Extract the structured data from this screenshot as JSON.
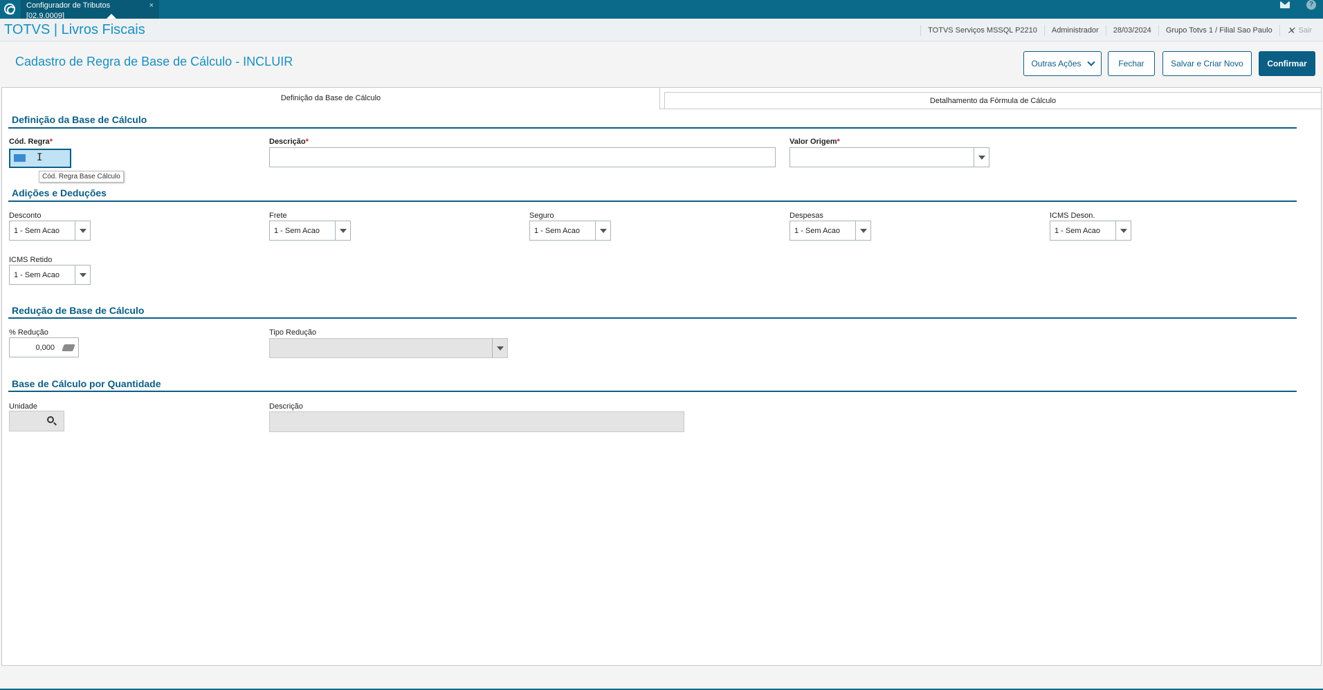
{
  "window": {
    "tab_title": "Configurador de Tributos [02.9.0009]",
    "tab_close": "×"
  },
  "header": {
    "brand": "TOTVS | Livros Fiscais",
    "environment": "TOTVS Serviços MSSQL P2210",
    "user": "Administrador",
    "date": "28/03/2024",
    "company": "Grupo Totvs 1 / Filial Sao Paulo",
    "exit_label": "Sair"
  },
  "page": {
    "title": "Cadastro de Regra de Base de Cálculo - INCLUIR"
  },
  "toolbar": {
    "other_actions": "Outras Ações",
    "close": "Fechar",
    "save_new": "Salvar e Criar Novo",
    "confirm": "Confirmar"
  },
  "tabs": {
    "definition": "Definição da Base de Cálculo",
    "formula": "Detalhamento da Fórmula de Cálculo"
  },
  "sections": {
    "definition": "Definição da Base de Cálculo",
    "adjustments": "Adições e Deduções",
    "reduction": "Redução de Base de Cálculo",
    "quantity": "Base de Cálculo por Quantidade"
  },
  "fields": {
    "cod_regra": {
      "label": "Cód. Regra",
      "tooltip": "Cód. Regra Base Cálculo"
    },
    "descricao": {
      "label": "Descrição",
      "value": ""
    },
    "valor_origem": {
      "label": "Valor Origem",
      "value": ""
    },
    "desconto": {
      "label": "Desconto",
      "value": "1 - Sem Acao"
    },
    "frete": {
      "label": "Frete",
      "value": "1 - Sem Acao"
    },
    "seguro": {
      "label": "Seguro",
      "value": "1 - Sem Acao"
    },
    "despesas": {
      "label": "Despesas",
      "value": "1 - Sem Acao"
    },
    "icms_deson": {
      "label": "ICMS Deson.",
      "value": "1 - Sem Acao"
    },
    "icms_retido": {
      "label": "ICMS Retido",
      "value": "1 - Sem Acao"
    },
    "pct_reducao": {
      "label": "% Redução",
      "value": "0,000"
    },
    "tipo_reducao": {
      "label": "Tipo Redução",
      "value": ""
    },
    "unidade": {
      "label": "Unidade",
      "value": ""
    },
    "descricao_unidade": {
      "label": "Descrição",
      "value": ""
    }
  },
  "required_marker": "*",
  "colors": {
    "topbar": "#0b6a8a",
    "brand": "#1a8fbf",
    "primary": "#0b5e84",
    "required": "#d02020"
  }
}
